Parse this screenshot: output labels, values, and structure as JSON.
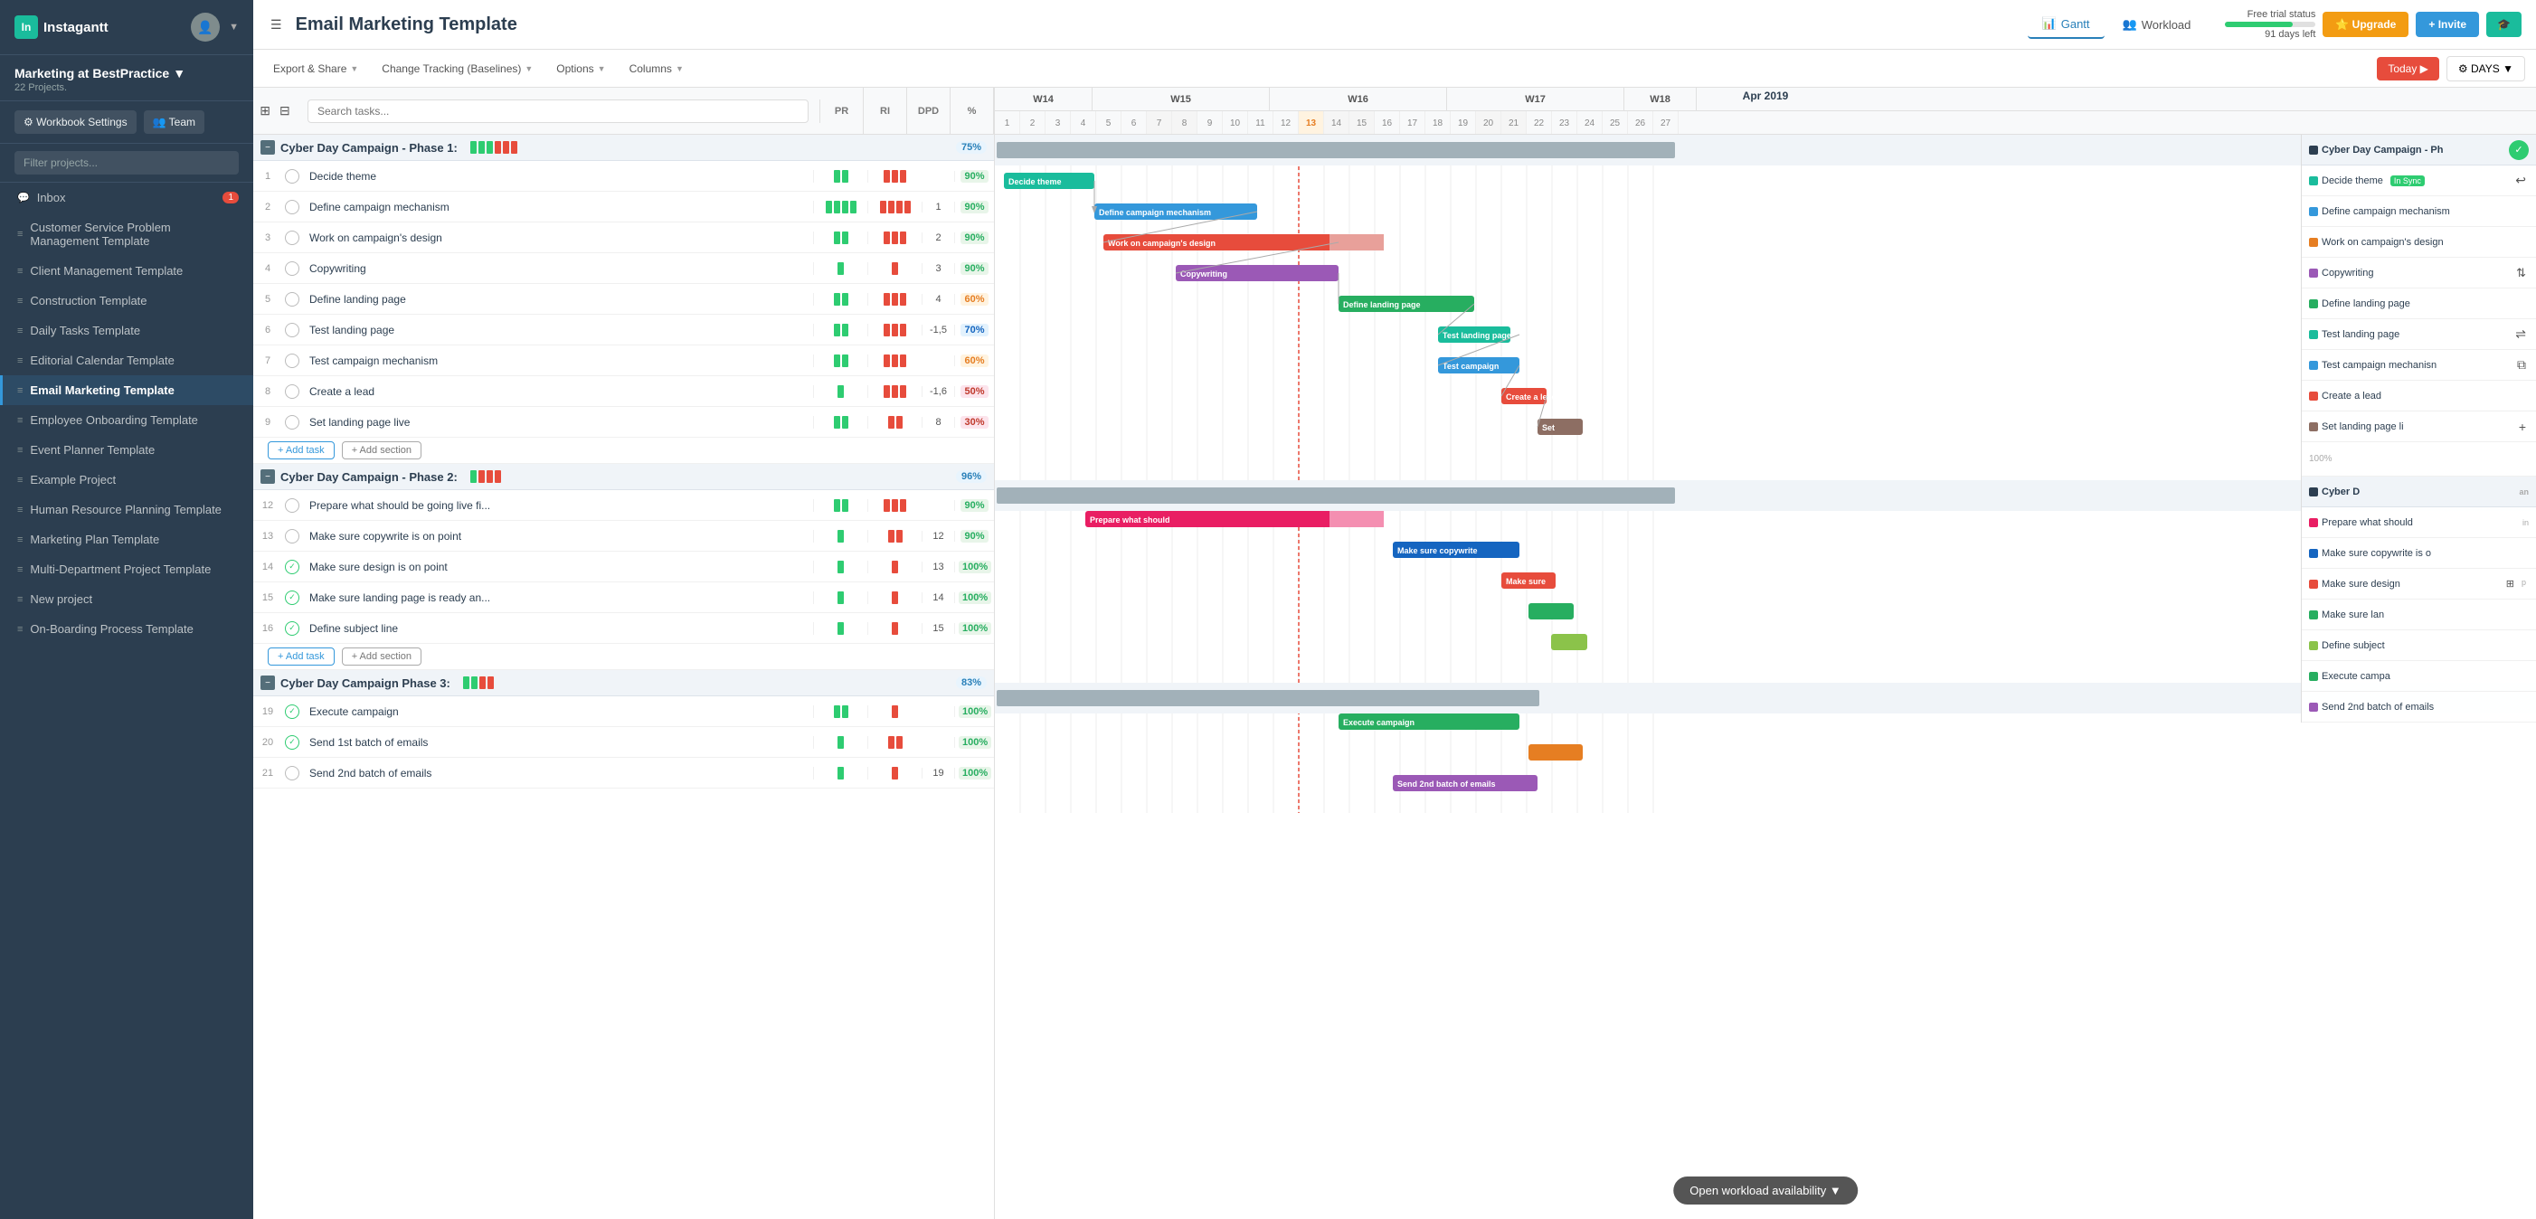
{
  "sidebar": {
    "logo": "Instagantt",
    "workspace": "Marketing at BestPractice",
    "workspace_chevron": "▼",
    "projects_count": "22 Projects.",
    "actions": [
      {
        "label": "⚙ Workbook Settings"
      },
      {
        "label": "👥 Team"
      }
    ],
    "filter_placeholder": "Filter projects...",
    "nav_items": [
      {
        "label": "Inbox",
        "badge": "1",
        "icon": "💬",
        "active": false
      },
      {
        "label": "Customer Service Problem Management Template",
        "icon": "≡",
        "active": false
      },
      {
        "label": "Client Management Template",
        "icon": "≡",
        "active": false
      },
      {
        "label": "Construction Template",
        "icon": "≡",
        "active": false
      },
      {
        "label": "Daily Tasks Template",
        "icon": "≡",
        "active": false
      },
      {
        "label": "Editorial Calendar Template",
        "icon": "≡",
        "active": false
      },
      {
        "label": "Email Marketing Template",
        "icon": "≡",
        "active": true
      },
      {
        "label": "Employee Onboarding Template",
        "icon": "≡",
        "active": false
      },
      {
        "label": "Event Planner Template",
        "icon": "≡",
        "active": false
      },
      {
        "label": "Example Project",
        "icon": "≡",
        "active": false
      },
      {
        "label": "Human Resource Planning Template",
        "icon": "≡",
        "active": false
      },
      {
        "label": "Marketing Plan Template",
        "icon": "≡",
        "active": false
      },
      {
        "label": "Multi-Department Project Template",
        "icon": "≡",
        "active": false
      },
      {
        "label": "New project",
        "icon": "≡",
        "active": false
      },
      {
        "label": "On-Boarding Process Template",
        "icon": "≡",
        "active": false
      }
    ]
  },
  "topbar": {
    "menu_icon": "☰",
    "title": "Email Marketing Template",
    "nav": [
      {
        "label": "📊 Gantt",
        "active": true
      },
      {
        "label": "👥 Workload",
        "active": false
      }
    ],
    "free_trial_label": "Free trial status",
    "free_trial_days": "91 days left",
    "upgrade_label": "⭐ Upgrade",
    "invite_label": "+ Invite",
    "grad_label": "🎓"
  },
  "toolbar": {
    "items": [
      {
        "label": "Export & Share ▼"
      },
      {
        "label": "Change Tracking (Baselines) ▼"
      },
      {
        "label": "Options ▼"
      },
      {
        "label": "Columns ▼"
      }
    ]
  },
  "task_panel": {
    "search_placeholder": "Search tasks...",
    "col_headers": [
      "PR",
      "RI",
      "DPD",
      "%"
    ],
    "groups": [
      {
        "name": "Cyber Day Campaign - Phase 1:",
        "collapsed": false,
        "pct": "75%",
        "tasks": [
          {
            "num": 1,
            "name": "Decide theme",
            "done": false,
            "dep": "",
            "pct": "90%",
            "pct_class": "pct-90"
          },
          {
            "num": 2,
            "name": "Define campaign mechanism",
            "done": false,
            "dep": "1",
            "pct": "90%",
            "pct_class": ""
          },
          {
            "num": 3,
            "name": "Work on campaign's design",
            "done": false,
            "dep": "2",
            "pct": "90%",
            "pct_class": ""
          },
          {
            "num": 4,
            "name": "Copywriting",
            "done": false,
            "dep": "3",
            "pct": "90%",
            "pct_class": ""
          },
          {
            "num": 5,
            "name": "Define landing page",
            "done": false,
            "dep": "4",
            "pct": "60%",
            "pct_class": "pct-60"
          },
          {
            "num": 6,
            "name": "Test landing page",
            "done": false,
            "dep": "-1,5",
            "pct": "70%",
            "pct_class": "pct-70"
          },
          {
            "num": 7,
            "name": "Test campaign mechanism",
            "done": false,
            "dep": "",
            "pct": "60%",
            "pct_class": "pct-60"
          },
          {
            "num": 8,
            "name": "Create a lead",
            "done": false,
            "dep": "-1,6",
            "pct": "50%",
            "pct_class": "pct-50"
          },
          {
            "num": 9,
            "name": "Set landing page live",
            "done": false,
            "dep": "8",
            "pct": "30%",
            "pct_class": "pct-30"
          }
        ]
      },
      {
        "name": "Cyber Day Campaign - Phase 2:",
        "collapsed": false,
        "pct": "96%",
        "tasks": [
          {
            "num": 12,
            "name": "Prepare what should be going live fi...",
            "done": false,
            "dep": "",
            "pct": "90%",
            "pct_class": ""
          },
          {
            "num": 13,
            "name": "Make sure copywrite is on point",
            "done": false,
            "dep": "12",
            "pct": "90%",
            "pct_class": ""
          },
          {
            "num": 14,
            "name": "Make sure design is on point",
            "done": true,
            "dep": "13",
            "pct": "100%",
            "pct_class": "pct-100"
          },
          {
            "num": 15,
            "name": "Make sure landing page is ready an...",
            "done": true,
            "dep": "14",
            "pct": "100%",
            "pct_class": "pct-100"
          },
          {
            "num": 16,
            "name": "Define subject line",
            "done": true,
            "dep": "15",
            "pct": "100%",
            "pct_class": "pct-100"
          }
        ]
      },
      {
        "name": "Cyber Day Campaign Phase 3:",
        "collapsed": false,
        "pct": "83%",
        "tasks": [
          {
            "num": 19,
            "name": "Execute campaign",
            "done": true,
            "dep": "",
            "pct": "100%",
            "pct_class": "pct-100"
          },
          {
            "num": 20,
            "name": "Send 1st batch of emails",
            "done": true,
            "dep": "",
            "pct": "100%",
            "pct_class": "pct-100"
          },
          {
            "num": 21,
            "name": "Send 2nd batch of emails",
            "done": false,
            "dep": "19",
            "pct": "100%",
            "pct_class": "pct-100"
          }
        ]
      }
    ],
    "add_task_label": "+ Add task",
    "add_section_label": "+ Add section"
  },
  "gantt": {
    "month_label": "Apr 2019",
    "weeks": [
      "W14",
      "W15",
      "W16",
      "W17",
      "W18"
    ],
    "today_label": "Today ▶",
    "days_label": "DAYS ▼",
    "right_labels": [
      {
        "label": "Cyber Day Campaign - Ph",
        "type": "group",
        "dot": "dark"
      },
      {
        "label": "Decide theme",
        "dot": "teal",
        "extra": "In Sync"
      },
      {
        "label": "Define campaign mechanism",
        "dot": "blue"
      },
      {
        "label": "Work on campaign's design",
        "dot": "orange"
      },
      {
        "label": "Copywriting",
        "dot": "purple"
      },
      {
        "label": "Define landing page",
        "dot": "green"
      },
      {
        "label": "Test landing page",
        "dot": "teal"
      },
      {
        "label": "Test campaign mechanisn",
        "dot": "blue"
      },
      {
        "label": "Create a lead",
        "dot": "red"
      },
      {
        "label": "Set landing page li",
        "dot": "brown"
      },
      {
        "label": "Cyber D",
        "type": "group",
        "dot": "dark"
      },
      {
        "label": "Prepare what should",
        "dot": "pink"
      },
      {
        "label": "Make sure copywrite is o",
        "dot": "darkblue"
      },
      {
        "label": "Make sure design p",
        "dot": "red"
      },
      {
        "label": "Make sure lan",
        "dot": "green"
      },
      {
        "label": "Define subject",
        "dot": "lime"
      },
      {
        "label": "Execute campa",
        "dot": "green"
      },
      {
        "label": "Send 2nd batch of emails",
        "dot": "purple"
      }
    ]
  },
  "workload_btn": "Open workload availability ▼"
}
